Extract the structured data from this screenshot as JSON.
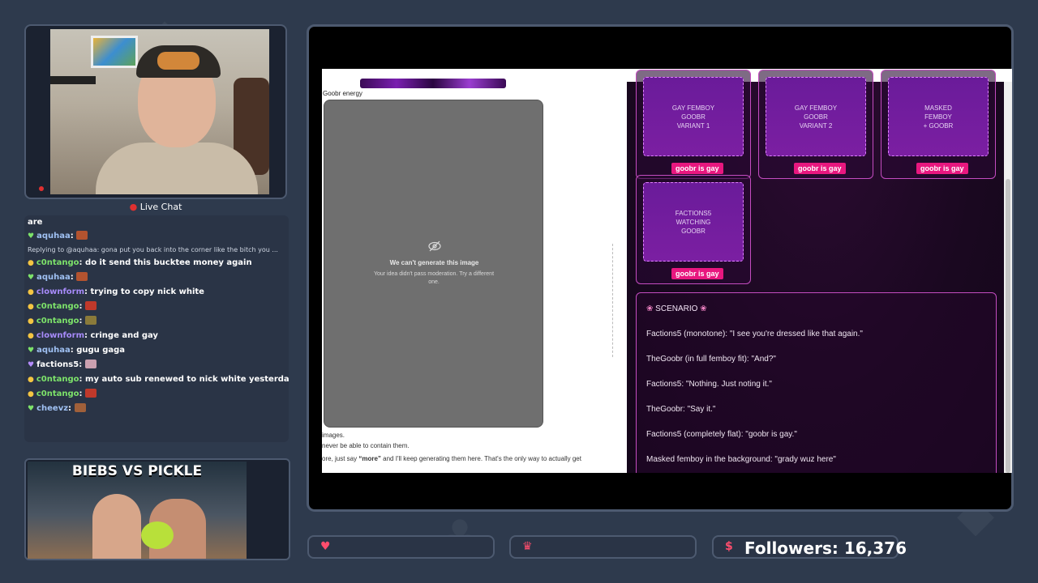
{
  "webcam": {
    "live_chat_title": "Live Chat"
  },
  "chat": {
    "partial_top": "are",
    "messages": [
      {
        "user": "aquhaa",
        "user_color": "#9fc0f2",
        "text": "",
        "emote": "#b3532f",
        "badge": "green"
      },
      {
        "reply": "Replying to @aquhaa: gona put you back into the corner like the bitch you ..."
      },
      {
        "user": "c0ntango",
        "user_color": "#7de36a",
        "text": "do it send this bucktee money again",
        "badge": "gold"
      },
      {
        "user": "aquhaa",
        "user_color": "#9fc0f2",
        "text": "",
        "emote": "#b3532f",
        "badge": "green"
      },
      {
        "user": "clownform",
        "user_color": "#a78bfa",
        "text": "trying to copy nick white",
        "badge": "gold"
      },
      {
        "user": "c0ntango",
        "user_color": "#7de36a",
        "text": "",
        "emote": "#c0392b",
        "badge": "gold"
      },
      {
        "user": "c0ntango",
        "user_color": "#7de36a",
        "text": "",
        "emote": "#8a7a3a",
        "badge": "gold"
      },
      {
        "user": "clownform",
        "user_color": "#a78bfa",
        "text": "cringe and gay",
        "badge": "gold"
      },
      {
        "user": "aquhaa",
        "user_color": "#9fc0f2",
        "text": "gugu gaga",
        "badge": "green"
      },
      {
        "user": "factions5",
        "user_color": "#ffffff",
        "text": "",
        "emote": "#caa0b0",
        "badge": "purple"
      },
      {
        "user": "c0ntango",
        "user_color": "#7de36a",
        "text": "my auto sub renewed to nick white yesterday",
        "badge": "gold"
      },
      {
        "user": "c0ntango",
        "user_color": "#7de36a",
        "text": "",
        "emote": "#c0392b",
        "badge": "gold"
      },
      {
        "user": "cheevz",
        "user_color": "#9fc0f2",
        "text": "",
        "emote": "#a0603a",
        "badge": "green"
      }
    ]
  },
  "promo": {
    "title": "BIEBS VS PICKLE"
  },
  "browser": {
    "left": {
      "image_label": "Goobr energy",
      "blocked_title": "We can't generate this image",
      "blocked_sub": "Your idea didn't pass moderation. Try a different one.",
      "text_line1": "images.",
      "text_line2": "never be able to contain them.",
      "text_line3_pre": "ore, just say ",
      "text_line3_bold": "“more”",
      "text_line3_post": " and I'll keep generating them here. That's the only way to actually get"
    },
    "variants": [
      {
        "caption": "GAY FEMBOY\nGOOBR\nVARIANT 1",
        "button": "goobr is gay"
      },
      {
        "caption": "GAY FEMBOY\nGOOBR\nVARIANT 2",
        "button": "goobr is gay"
      },
      {
        "caption": "MASKED\nFEMBOY\n+ GOOBR",
        "button": "goobr is gay"
      },
      {
        "caption": "FACTIONS5\nWATCHING\nGOOBR",
        "button": "goobr is gay"
      }
    ],
    "scenario": {
      "heading": "SCENARIO",
      "lines": [
        "Factions5 (monotone): \"I see you're dressed like that again.\"",
        "TheGoobr (in full femboy fit): \"And?\"",
        "Factions5: \"Nothing. Just noting it.\"",
        "TheGoobr: \"Say it.\"",
        "Factions5 (completely flat): \"goobr is gay.\"",
        "Masked femboy in the background: \"grady wuz here\""
      ]
    }
  },
  "bottom": {
    "followers_label": "Followers: 16,376"
  },
  "colors": {
    "accent_pink": "#e8177f",
    "card_border": "#c44cc0",
    "panel_bg": "#2a3446"
  }
}
